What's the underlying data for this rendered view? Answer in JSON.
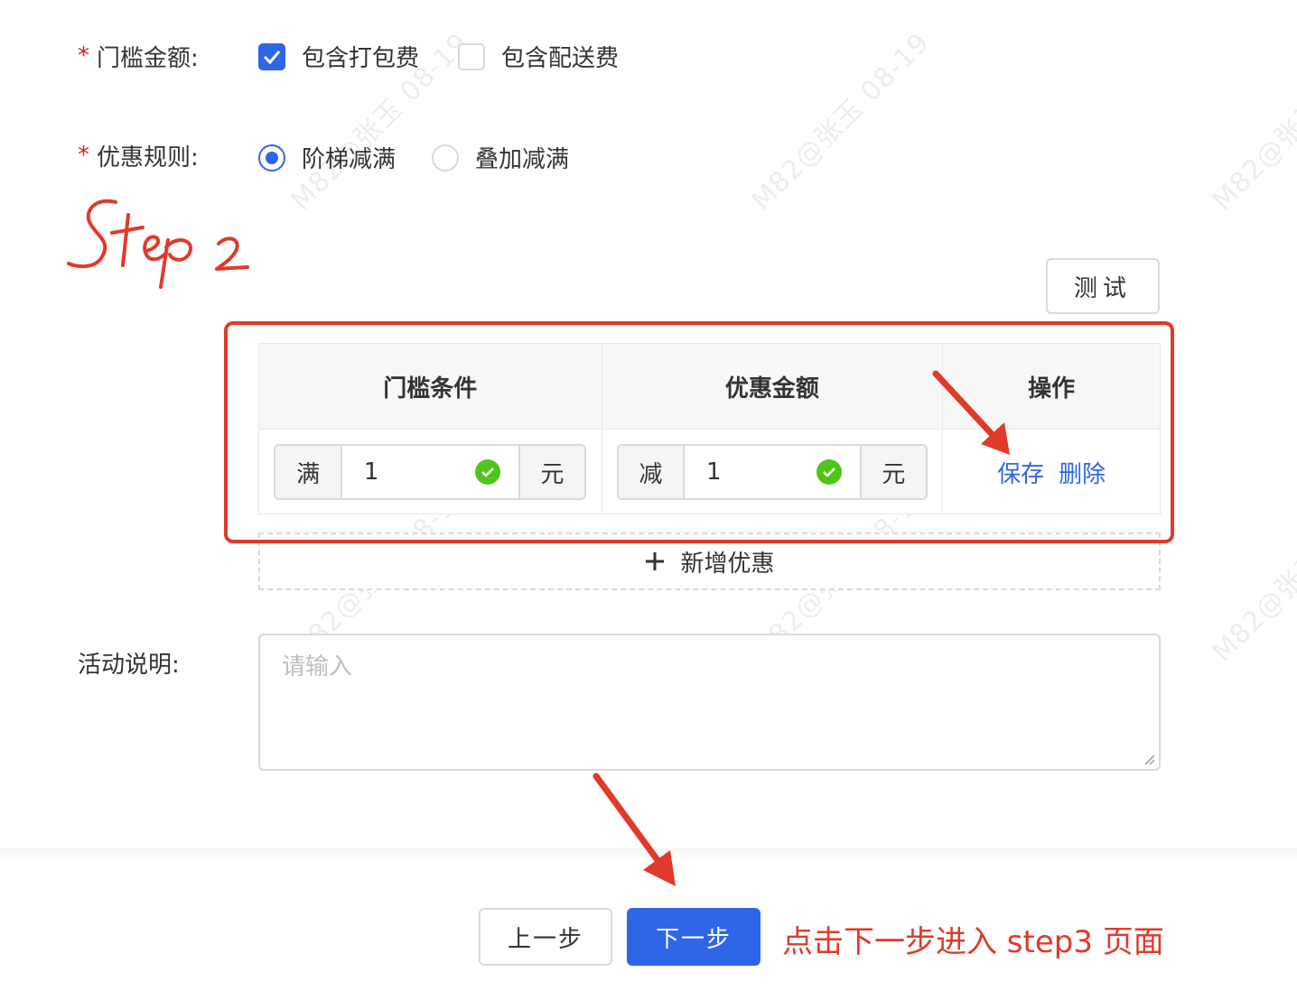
{
  "watermark": "M82@张玉 08-19",
  "form": {
    "threshold_label": "门槛金额:",
    "threshold_options": [
      {
        "label": "包含打包费",
        "checked": true
      },
      {
        "label": "包含配送费",
        "checked": false
      }
    ],
    "rule_label": "优惠规则:",
    "rule_options": [
      {
        "label": "阶梯减满",
        "selected": true
      },
      {
        "label": "叠加减满",
        "selected": false
      }
    ],
    "description_label": "活动说明:",
    "description_placeholder": "请输入"
  },
  "annotation_step": "Step 2",
  "test_button": "测试",
  "table": {
    "headers": [
      "门槛条件",
      "优惠金额",
      "操作"
    ],
    "row": {
      "condition_prefix": "满",
      "condition_value": "1",
      "condition_suffix": "元",
      "discount_prefix": "减",
      "discount_value": "1",
      "discount_suffix": "元",
      "actions": [
        "保存",
        "删除"
      ]
    },
    "add_label": "新增优惠"
  },
  "footer": {
    "prev_label": "上一步",
    "next_label": "下一步",
    "annotation": "点击下一步进入 step3 页面"
  },
  "colors": {
    "primary": "#2f66e8",
    "annotation_red": "#e03a2a",
    "success": "#52c41a"
  }
}
